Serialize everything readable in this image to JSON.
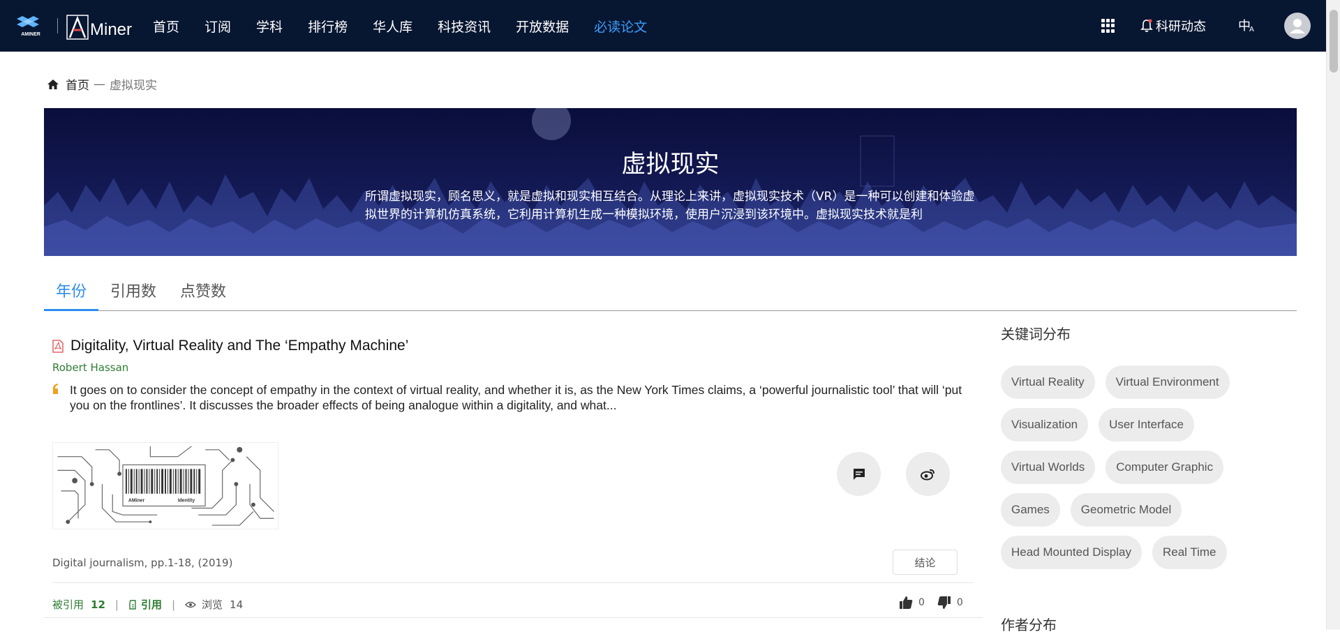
{
  "nav": {
    "items": [
      "首页",
      "订阅",
      "学科",
      "排行榜",
      "华人库",
      "科技资讯",
      "开放数据",
      "必读论文"
    ],
    "active_index": 7,
    "brand_logo_b_text": "Miner",
    "brand_logo_a_text": "AMINER",
    "notice_label": "科研动态",
    "lang_label": "中",
    "lang_sub": "A"
  },
  "breadcrumb": {
    "home": "首页",
    "separator": "—",
    "current": "虚拟现实"
  },
  "banner": {
    "title": "虚拟现实",
    "description": "所谓虚拟现实，顾名思义，就是虚拟和现实相互结合。从理论上来讲，虚拟现实技术（VR）是一种可以创建和体验虚拟世界的计算机仿真系统，它利用计算机生成一种模拟环境，使用户沉浸到该环境中。虚拟现实技术就是利"
  },
  "tabs": [
    {
      "label": "年份",
      "active": true
    },
    {
      "label": "引用数",
      "active": false
    },
    {
      "label": "点赞数",
      "active": false
    }
  ],
  "paper": {
    "title": "Digitality, Virtual Reality and The ‘Empathy Machine’",
    "author": "Robert Hassan",
    "abstract": "It goes on to consider the concept of empathy in the context of virtual reality, and whether it is, as the New York Times claims, a ‘powerful journalistic tool’ that will ‘put you on the frontlines’. It discusses the broader effects of being analogue within a digitality, and what...",
    "thumbnail_label_left": "AMiner",
    "thumbnail_label_right": "Identity",
    "venue": "Digital journalism, pp.1-18, (2019)",
    "conclusion_label": "结论",
    "cited_label": "被引用",
    "cited_count": "12",
    "cite_label": "引用",
    "view_label": "浏览",
    "view_count": "14",
    "likes": "0",
    "dislikes": "0"
  },
  "sidebar": {
    "keywords_title": "关键词分布",
    "keywords": [
      "Virtual Reality",
      "Virtual Environment",
      "Visualization",
      "User Interface",
      "Virtual Worlds",
      "Computer Graphic",
      "Games",
      "Geometric Model",
      "Head Mounted Display",
      "Real Time"
    ],
    "authors_title": "作者分布"
  },
  "colors": {
    "topbar": "#071631",
    "active_nav": "#3d9eff",
    "tab_active": "#2d8cf0",
    "author_green": "#2e7d32",
    "pdf_red": "#e0484e",
    "quote_orange": "#f0a020"
  }
}
